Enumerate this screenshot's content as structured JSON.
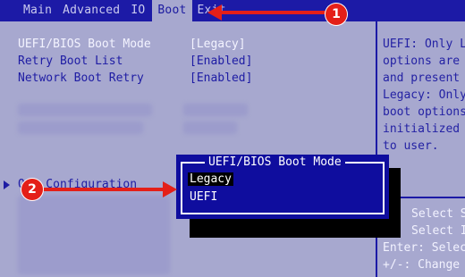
{
  "menu": {
    "tabs": [
      {
        "label": "Main"
      },
      {
        "label": "Advanced"
      },
      {
        "label": "IO"
      },
      {
        "label": "Boot"
      },
      {
        "label": "Exit"
      }
    ],
    "active_tab": "Boot"
  },
  "settings": [
    {
      "label": "UEFI/BIOS Boot Mode",
      "value": "[Legacy]"
    },
    {
      "label": "Retry Boot List",
      "value": "[Enabled]"
    },
    {
      "label": "Network Boot Retry",
      "value": "[Enabled]"
    }
  ],
  "submenu": {
    "label": "OSA Configuration"
  },
  "popup": {
    "title": "UEFI/BIOS Boot Mode",
    "options": [
      {
        "label": "Legacy",
        "selected": true
      },
      {
        "label": "UEFI",
        "selected": false
      }
    ]
  },
  "help": {
    "lines": [
      "UEFI: Only L",
      "options are",
      "and present",
      "Legacy: Only",
      "boot options",
      "initialized",
      "to user."
    ],
    "keys": [
      "Select S",
      "Select I",
      "Enter: Selec",
      "+/-: Change"
    ]
  },
  "annotations": {
    "badge1": "1",
    "badge2": "2"
  },
  "colors": {
    "background": "#a7a8cf",
    "menubar": "#1c1aa6",
    "popup": "#0f0d9e",
    "annotation": "#e41f18"
  }
}
